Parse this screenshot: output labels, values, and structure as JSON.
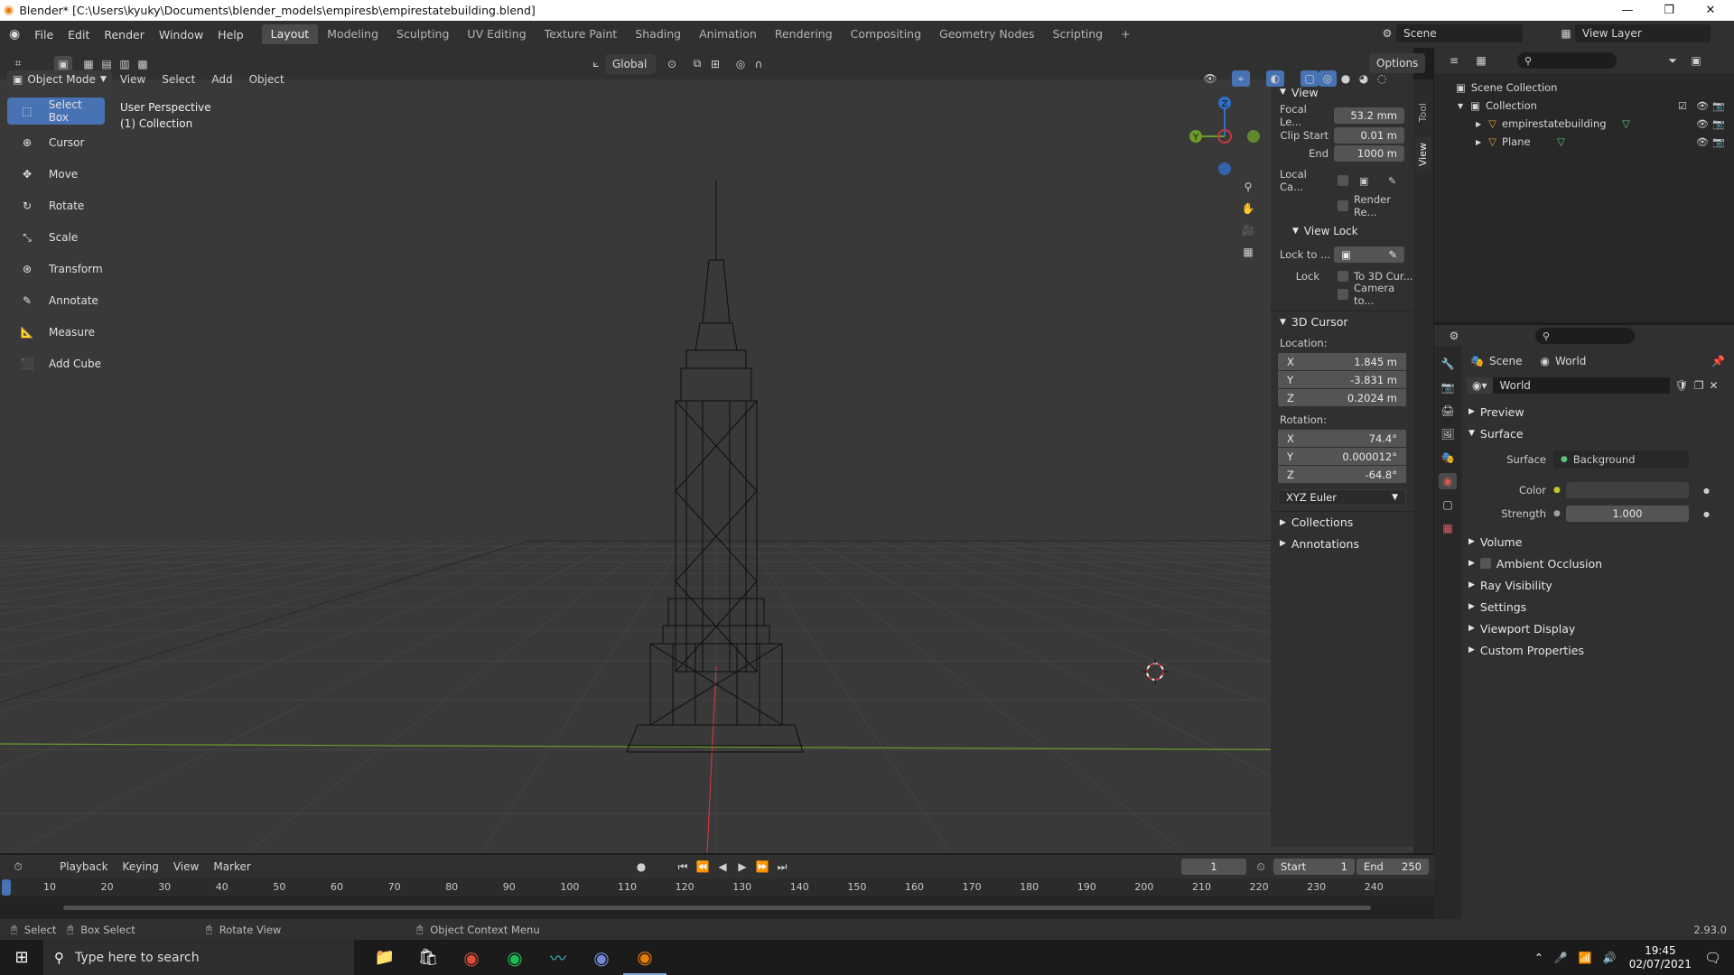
{
  "title_bar": {
    "title": "Blender* [C:\\Users\\kyuky\\Documents\\blender_models\\empiresb\\empirestatebuilding.blend]"
  },
  "menu": {
    "items": [
      "File",
      "Edit",
      "Render",
      "Window",
      "Help"
    ],
    "workspaces": [
      "Layout",
      "Modeling",
      "Sculpting",
      "UV Editing",
      "Texture Paint",
      "Shading",
      "Animation",
      "Rendering",
      "Compositing",
      "Geometry Nodes",
      "Scripting"
    ],
    "active_workspace": "Layout",
    "scene_label": "Scene",
    "view_layer_label": "View Layer"
  },
  "viewport_header": {
    "mode": "Object Mode",
    "menus": [
      "View",
      "Select",
      "Add",
      "Object"
    ],
    "transform_orientation": "Global",
    "options_label": "Options"
  },
  "viewport": {
    "view_name": "User Perspective",
    "collection_label": "(1) Collection",
    "tools": [
      "Select Box",
      "Cursor",
      "Move",
      "Rotate",
      "Scale",
      "Transform",
      "Annotate",
      "Measure",
      "Add Cube"
    ],
    "active_tool": "Select Box"
  },
  "npanel": {
    "view_title": "View",
    "focal_label": "Focal Le...",
    "focal_value": "53.2 mm",
    "clip_start_label": "Clip Start",
    "clip_start_value": "0.01 m",
    "end_label": "End",
    "end_value": "1000 m",
    "local_camera_label": "Local Ca...",
    "render_region_label": "Render Re...",
    "view_lock_title": "View Lock",
    "lock_to_label": "Lock to ...",
    "lock_label": "Lock",
    "to_3d_cursor_label": "To 3D Cur...",
    "camera_to_label": "Camera to...",
    "cursor_title": "3D Cursor",
    "location_label": "Location:",
    "location": {
      "x": "1.845 m",
      "y": "-3.831 m",
      "z": "0.2024 m"
    },
    "rotation_label": "Rotation:",
    "rotation": {
      "x": "74.4°",
      "y": "0.000012°",
      "z": "-64.8°"
    },
    "rotation_mode": "XYZ Euler",
    "collections_title": "Collections",
    "annotations_title": "Annotations",
    "tab_tool": "Tool",
    "tab_view": "View"
  },
  "outliner": {
    "scene_collection": "Scene Collection",
    "collection": "Collection",
    "objects": [
      "empirestatebuilding",
      "Plane"
    ]
  },
  "properties": {
    "breadcrumb_scene": "Scene",
    "breadcrumb_world": "World",
    "world_name": "World",
    "panels": {
      "preview": "Preview",
      "surface": "Surface",
      "volume": "Volume",
      "ambient_occlusion": "Ambient Occlusion",
      "ray_visibility": "Ray Visibility",
      "settings": "Settings",
      "viewport_display": "Viewport Display",
      "custom_properties": "Custom Properties"
    },
    "surface_label": "Surface",
    "surface_value": "Background",
    "color_label": "Color",
    "strength_label": "Strength",
    "strength_value": "1.000"
  },
  "timeline": {
    "menus": [
      "Playback",
      "Keying",
      "View",
      "Marker"
    ],
    "current_frame": "1",
    "start_label": "Start",
    "start_value": "1",
    "end_label": "End",
    "end_value": "250",
    "ruler": [
      "10",
      "20",
      "30",
      "40",
      "50",
      "60",
      "70",
      "80",
      "90",
      "100",
      "110",
      "120",
      "130",
      "140",
      "150",
      "160",
      "170",
      "180",
      "190",
      "200",
      "210",
      "220",
      "230",
      "240"
    ]
  },
  "status_bar": {
    "select": "Select",
    "box_select": "Box Select",
    "rotate_view": "Rotate View",
    "context_menu": "Object Context Menu",
    "version": "2.93.0"
  },
  "taskbar": {
    "search_placeholder": "Type here to search",
    "time": "19:45",
    "date": "02/07/2021"
  },
  "colors": {
    "accent": "#4772b3",
    "axis_x": "#c9383f",
    "axis_y": "#6b9c2a",
    "axis_z": "#2f6fc8"
  }
}
